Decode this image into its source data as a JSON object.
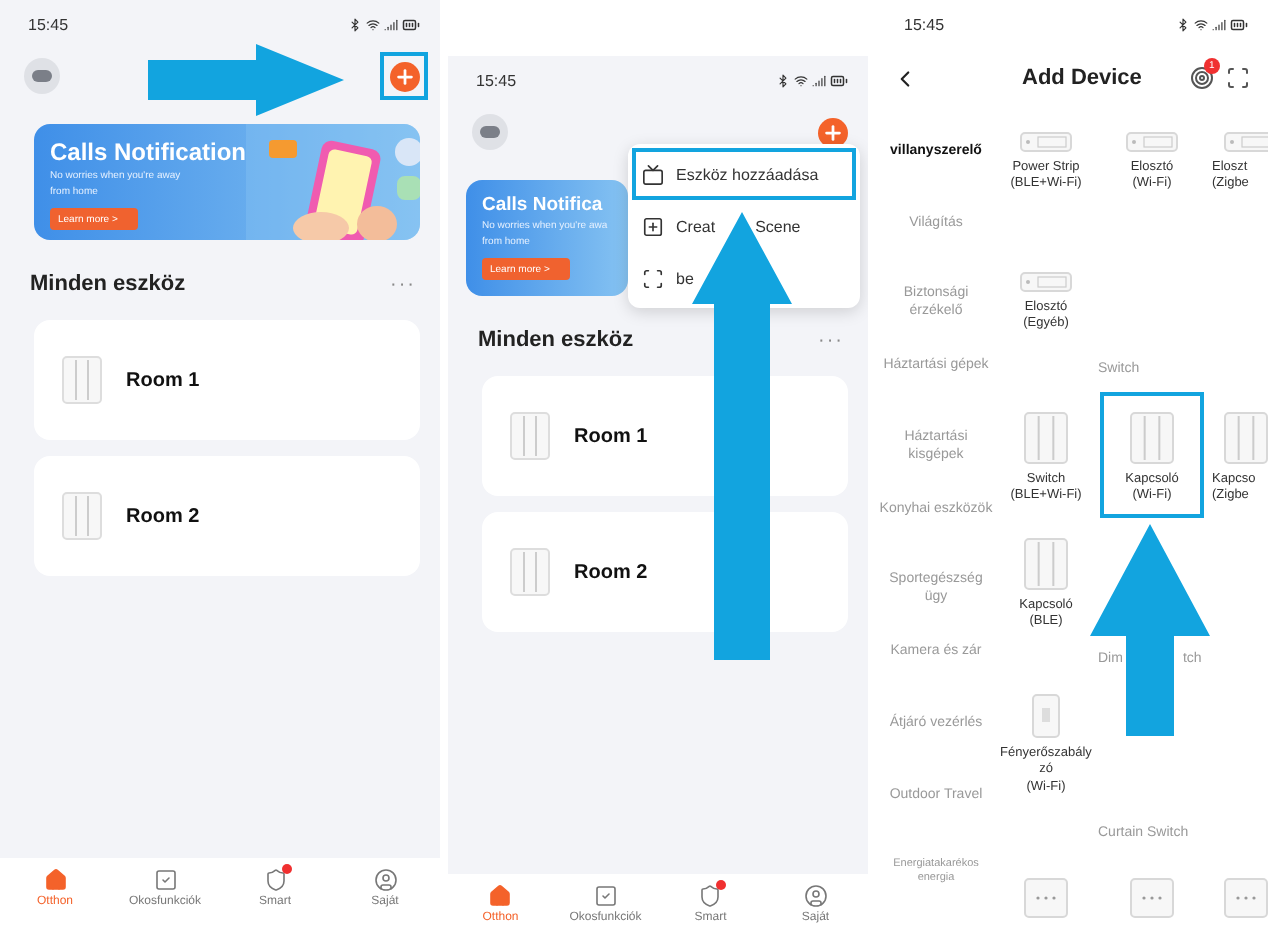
{
  "home_screens": [
    {
      "status_time": "15:45",
      "add_highlighted": true,
      "banner": {
        "title": "Calls Notification",
        "subtitle": [
          "No worries when you're away",
          "from home"
        ],
        "button": "Learn more >"
      },
      "section_title": "Minden eszköz",
      "more": "···",
      "rooms": [
        {
          "name": "Room 1"
        },
        {
          "name": "Room 2"
        }
      ],
      "tabs": [
        {
          "label": "Otthon",
          "selected": true,
          "badge": false
        },
        {
          "label": "Okosfunkciók",
          "selected": false,
          "badge": false
        },
        {
          "label": "Smart",
          "selected": false,
          "badge": true
        },
        {
          "label": "Saját",
          "selected": false,
          "badge": false
        }
      ]
    },
    {
      "status_time": "15:45",
      "add_highlighted": false,
      "banner": {
        "title": "Calls Notifica",
        "subtitle": [
          "No worries when you're awa",
          "from home"
        ],
        "button": "Learn more >"
      },
      "section_title": "Minden eszköz",
      "more": "···",
      "rooms": [
        {
          "name": "Room 1"
        },
        {
          "name": "Room 2"
        }
      ],
      "menu": [
        {
          "label": "Eszköz hozzáadása",
          "highlighted": true
        },
        {
          "label": "Creat",
          "label_end": "Scene",
          "highlighted": false
        },
        {
          "label": "be",
          "highlighted": false
        }
      ],
      "tabs": [
        {
          "label": "Otthon",
          "selected": true,
          "badge": false
        },
        {
          "label": "Okosfunkciók",
          "selected": false,
          "badge": false
        },
        {
          "label": "Smart",
          "selected": false,
          "badge": true
        },
        {
          "label": "Saját",
          "selected": false,
          "badge": false
        }
      ]
    }
  ],
  "add_device": {
    "status_time": "15:45",
    "title": "Add Device",
    "notification_count": "1",
    "categories": [
      {
        "label": "villanyszerelő",
        "selected": true
      },
      {
        "label": "Világítás",
        "selected": false
      },
      {
        "label": "Biztonsági érzékelő",
        "selected": false
      },
      {
        "label": "Háztartási gépek",
        "selected": false
      },
      {
        "label": "Háztartási kisgépek",
        "selected": false
      },
      {
        "label": "Konyhai eszközök",
        "selected": false
      },
      {
        "label": "Sportegészség ügy",
        "selected": false
      },
      {
        "label": "Kamera és zár",
        "selected": false
      },
      {
        "label": "Átjáró vezérlés",
        "selected": false
      },
      {
        "label": "Outdoor Travel",
        "selected": false
      },
      {
        "label": "Energiatakarékos energia",
        "selected": false
      }
    ],
    "sections": [
      {
        "items": [
          {
            "name": "Power Strip",
            "sub": "(BLE+Wi-Fi)",
            "kind": "strip",
            "highlighted": false
          },
          {
            "name": "Elosztó",
            "sub": "(Wi-Fi)",
            "kind": "strip",
            "highlighted": false
          },
          {
            "name": "Eloszt",
            "sub": "(Zigbe",
            "kind": "strip",
            "highlighted": false
          },
          {
            "name": "Elosztó",
            "sub": "(Egyéb)",
            "kind": "strip",
            "highlighted": false
          }
        ]
      },
      {
        "title": "Switch",
        "items": [
          {
            "name": "Switch",
            "sub": "(BLE+Wi-Fi)",
            "kind": "switch",
            "highlighted": false
          },
          {
            "name": "Kapcsoló",
            "sub": "(Wi-Fi)",
            "kind": "switch",
            "highlighted": true
          },
          {
            "name": "Kapcso",
            "sub": "(Zigbe",
            "kind": "switch",
            "highlighted": false
          },
          {
            "name": "Kapcsoló",
            "sub": "(BLE)",
            "kind": "switch",
            "highlighted": false
          }
        ]
      },
      {
        "title": "Dim",
        "title_end": "tch",
        "items": [
          {
            "name": "Fényerőszabályzó",
            "sub": "(Wi-Fi)",
            "kind": "dimmer",
            "highlighted": false
          }
        ]
      },
      {
        "title": "Curtain Switch",
        "items": [
          {
            "kind": "curtain",
            "highlighted": false
          },
          {
            "kind": "curtain",
            "highlighted": false
          },
          {
            "kind": "curtain",
            "highlighted": false
          }
        ]
      }
    ]
  }
}
